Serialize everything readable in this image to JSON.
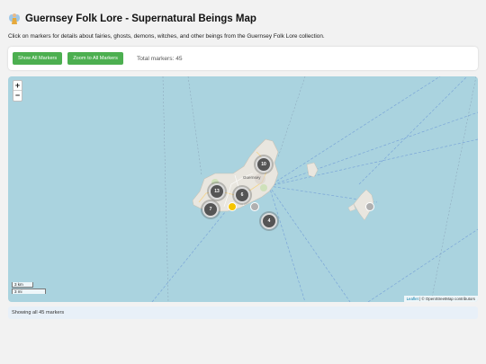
{
  "header": {
    "title": "Guernsey Folk Lore - Supernatural Beings Map",
    "subtitle": "Click on markers for details about fairies, ghosts, demons, witches, and other beings from the Guernsey Folk Lore collection."
  },
  "controls": {
    "show_all_label": "Show All Markers",
    "zoom_all_label": "Zoom to All Markers",
    "total_label": "Total markers: 45"
  },
  "map": {
    "zoom_in": "+",
    "zoom_out": "−",
    "island_label": "Guernsey",
    "scale_km": "3 km",
    "scale_mi": "3 mi",
    "attribution_leaflet": "Leaflet",
    "attribution_rest": " | © OpenStreetMap contributors",
    "clusters": [
      {
        "count": "10"
      },
      {
        "count": "13"
      },
      {
        "count": "6"
      },
      {
        "count": "7"
      },
      {
        "count": "4"
      }
    ],
    "markers": [
      {
        "color": "#f5c400"
      },
      {
        "color": "#b0b0b0"
      },
      {
        "color": "#b0b0b0"
      }
    ]
  },
  "status": {
    "text": "Showing all 45 markers"
  },
  "colors": {
    "button": "#4caf50",
    "sea": "#aad3df",
    "cluster": "#555555"
  }
}
